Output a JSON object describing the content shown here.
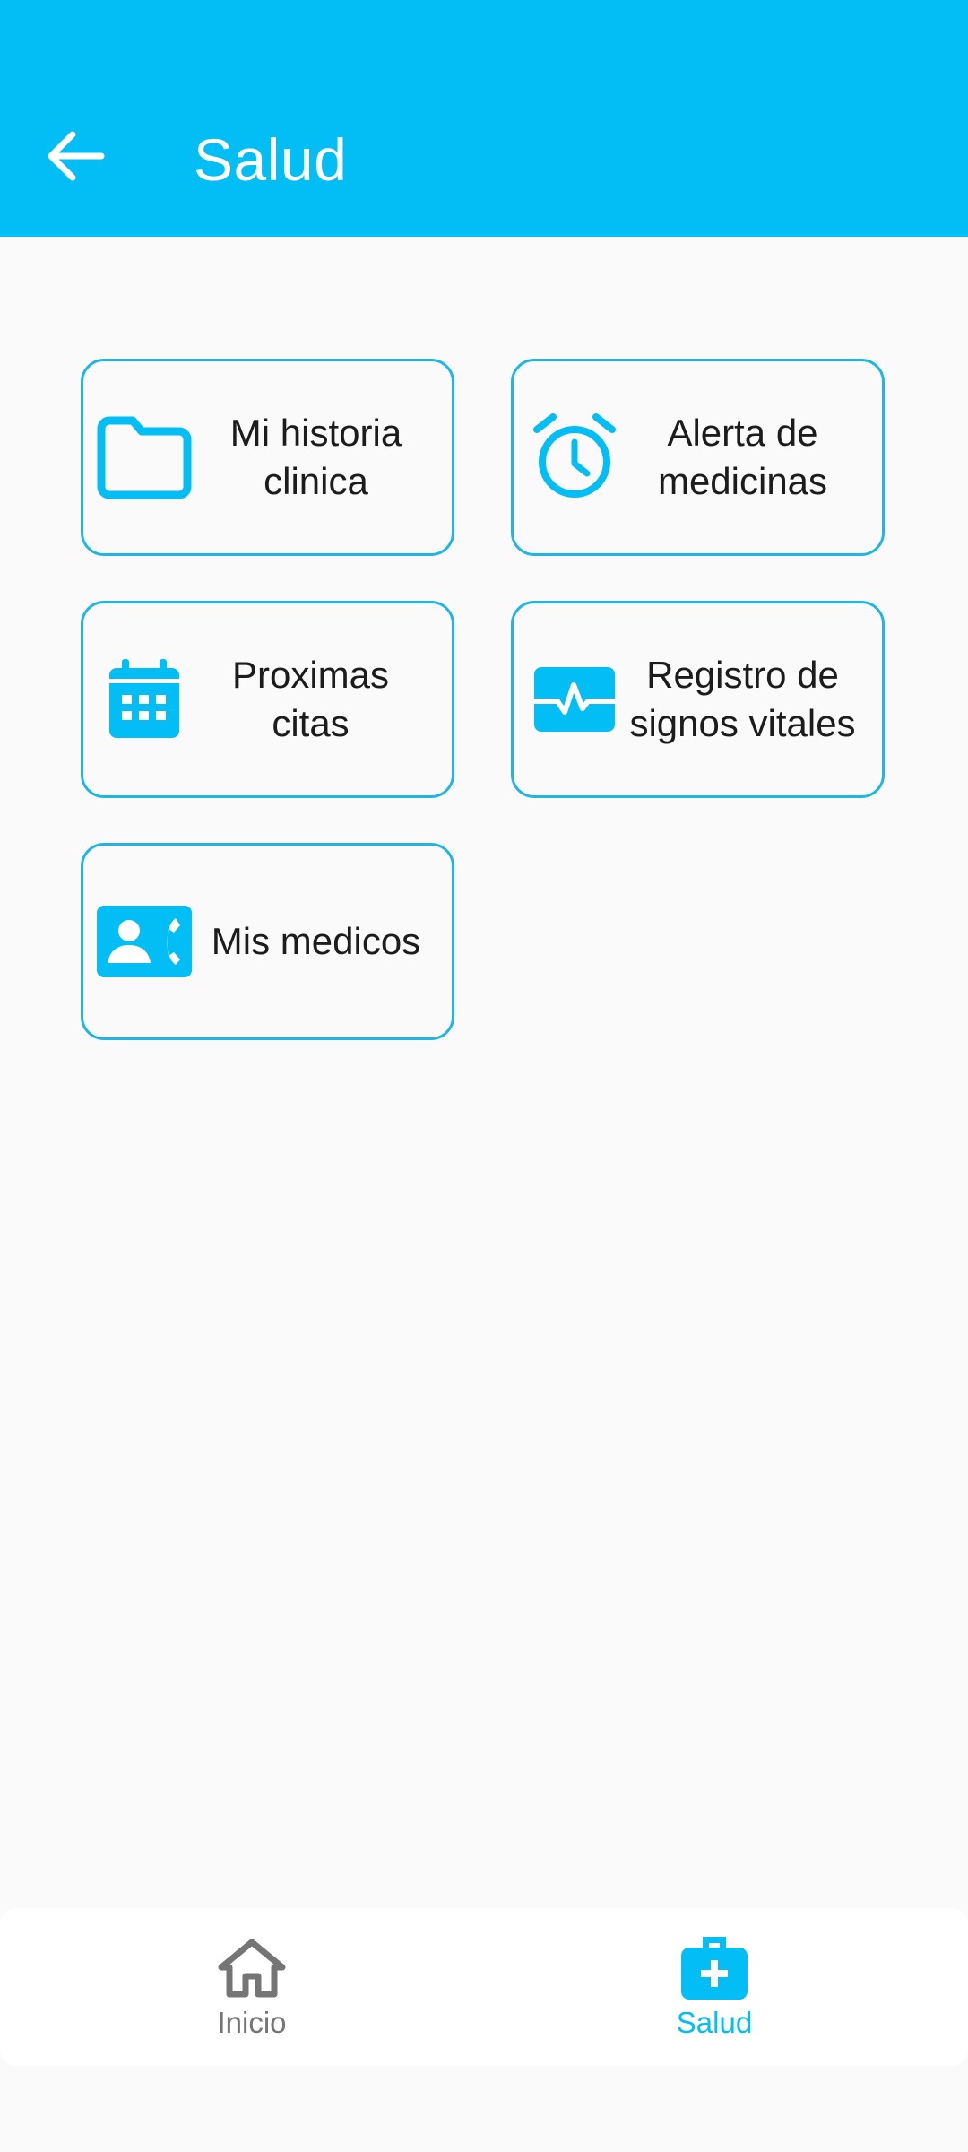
{
  "appbar": {
    "title": "Salud",
    "back_icon": "arrow-back-icon",
    "background": "#03BDF5"
  },
  "accent_color": "#03BDF5",
  "cards": [
    {
      "label": "Mi historia\nclinica",
      "icon": "folder-icon"
    },
    {
      "label": "Alerta de\nmedicinas",
      "icon": "alarm-clock-icon"
    },
    {
      "label": "Proximas\ncitas",
      "icon": "calendar-icon"
    },
    {
      "label": "Registro de\nsignos vitales",
      "icon": "vital-signs-icon"
    },
    {
      "label": "Mis medicos",
      "icon": "contact-phone-icon"
    }
  ],
  "bottom_nav": {
    "items": [
      {
        "label": "Inicio",
        "icon": "home-icon",
        "active": false,
        "color": "#757575"
      },
      {
        "label": "Salud",
        "icon": "medical-bag-icon",
        "active": true,
        "color": "#03BDF5"
      }
    ]
  }
}
